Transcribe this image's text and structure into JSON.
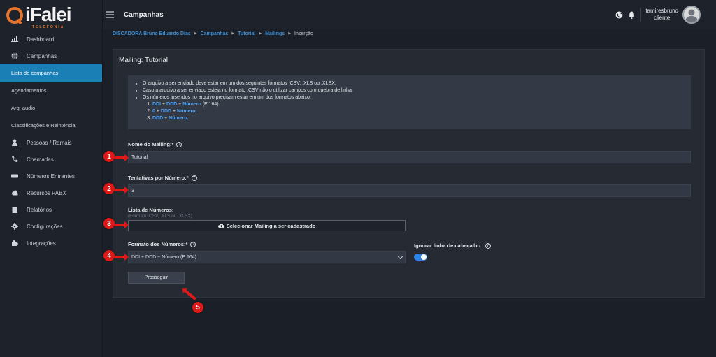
{
  "logo": {
    "text": "iFalei",
    "sub": "TELEFONIA"
  },
  "sidebar": {
    "items": [
      {
        "label": "Dashboard",
        "icon": "chart-icon"
      },
      {
        "label": "Campanhas",
        "icon": "globe-icon"
      },
      {
        "label": "Lista de campanhas",
        "sub": true,
        "active": true
      },
      {
        "label": "Agendamentos",
        "sub": true
      },
      {
        "label": "Arq. audio",
        "sub": true
      },
      {
        "label": "Classificações e Reintência",
        "sub": true
      },
      {
        "label": "Pessoas / Ramais",
        "icon": "person-icon"
      },
      {
        "label": "Chamadas",
        "icon": "phone-icon"
      },
      {
        "label": "Números Entrantes",
        "icon": "keypad-icon"
      },
      {
        "label": "Recursos PABX",
        "icon": "cloud-icon"
      },
      {
        "label": "Relatórios",
        "icon": "clipboard-icon"
      },
      {
        "label": "Configurações",
        "icon": "gear-icon"
      },
      {
        "label": "Integrações",
        "icon": "puzzle-icon"
      }
    ]
  },
  "header": {
    "title": "Campanhas",
    "user_name": "tamiresbruno",
    "user_role": "cliente"
  },
  "breadcrumb": {
    "items": [
      "DISCADORA Bruno Eduardo Dias",
      "Campanhas",
      "Tutorial",
      "Mailings"
    ],
    "current": "Inserção"
  },
  "card": {
    "title": "Mailing: Tutorial",
    "info": {
      "line1": "O arquivo a ser enviado deve estar em um dos seguintes formatos .CSV, .XLS ou .XLSX.",
      "line2": "Caso a arquivo a ser enviado esteja no formato .CSV não o utilizar campos com quebra de linha.",
      "line3": "Os números inseridos no arquivo precisam estar em um dos formatos abaixo:",
      "f1_a": "DDI",
      "f1_b": "DDD",
      "f1_c": "Número",
      "f1_d": "(E.164).",
      "f2_a": "0",
      "f2_b": "DDD",
      "f2_c": "Número.",
      "f3_a": "DDD",
      "f3_b": "Número."
    },
    "mailing_name_label": "Nome do Mailing:*",
    "mailing_name_value": "Tutorial",
    "attempts_label": "Tentativas por Número:*",
    "attempts_value": "3",
    "numbers_label": "Lista de Números:",
    "numbers_hint": "(Formato .CSV, .XLS ou .XLSX)",
    "upload_label": "Selecionar Mailing a ser cadastrado",
    "format_label": "Formato dos Números:*",
    "format_value": "DDI + DDD + Número (E.164)",
    "ignore_header_label": "Ignorar linha de cabeçalho:",
    "ignore_header_on": true,
    "proceed_label": "Prosseguir"
  },
  "annotations": [
    "1",
    "2",
    "3",
    "4",
    "5"
  ],
  "colors": {
    "accent": "#1a7fb5",
    "link": "#3c8fd6",
    "marker": "#e01818",
    "toggle": "#2f7fe4"
  }
}
